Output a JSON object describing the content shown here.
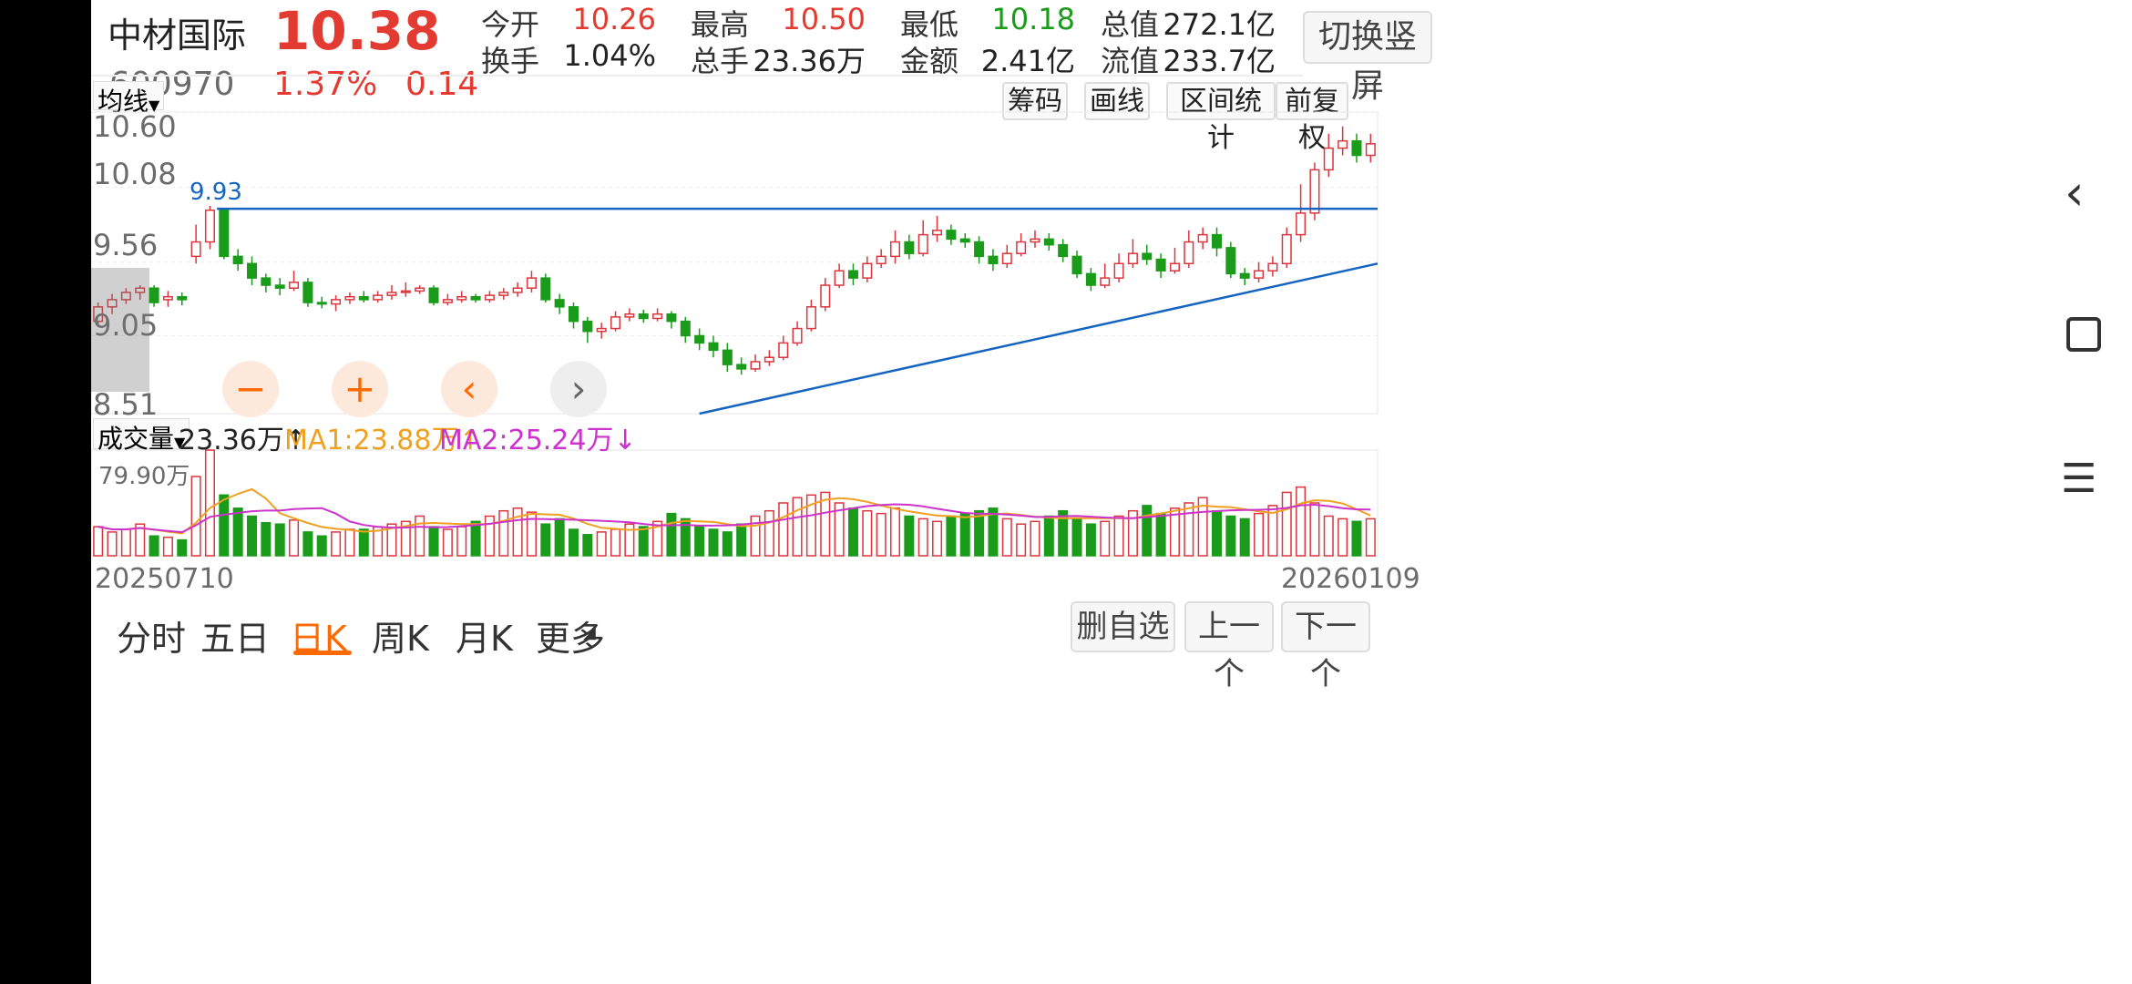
{
  "header": {
    "stock_name": "中材国际",
    "price": "10.38",
    "code": "600970",
    "change_pct": "1.37%",
    "change": "0.14",
    "fields": [
      {
        "label": "今开",
        "value": "10.26",
        "color": "#e33b32"
      },
      {
        "label": "最高",
        "value": "10.50",
        "color": "#e33b32"
      },
      {
        "label": "最低",
        "value": "10.18",
        "color": "#1a9c1a"
      },
      {
        "label": "总值",
        "value": "272.1亿",
        "color": "#222222"
      },
      {
        "label": "换手",
        "value": "1.04%",
        "color": "#222222"
      },
      {
        "label": "总手",
        "value": "23.36万",
        "color": "#222222"
      },
      {
        "label": "金额",
        "value": "2.41亿",
        "color": "#222222"
      },
      {
        "label": "流值",
        "value": "233.7亿",
        "color": "#222222"
      }
    ],
    "switch_label": "切换竖屏"
  },
  "toolbar": {
    "ma_label": "均线",
    "buttons": [
      "筹码",
      "画线",
      "区间统计",
      "前复权"
    ]
  },
  "price_axis": {
    "ticks": [
      "10.60",
      "10.08",
      "9.56",
      "9.05",
      "8.51"
    ]
  },
  "annotations": {
    "high_label": "9.93"
  },
  "volume_header": {
    "label": "成交量",
    "value": "23.36万",
    "value_arrow": "↑",
    "ma1": "MA1:23.88万",
    "ma1_arrow": "↑",
    "ma2": "MA2:25.24万",
    "ma2_arrow": "↓",
    "max_label": "79.90万"
  },
  "dates": {
    "start": "20250710",
    "end": "20260109"
  },
  "controls": {
    "zoom_out": "−",
    "zoom_in": "+",
    "prev": "‹",
    "next": "›"
  },
  "tabs": [
    "分时",
    "五日",
    "日K",
    "周K",
    "月K",
    "更多"
  ],
  "active_tab": "日K",
  "bottom_buttons": [
    "删自选",
    "上一个",
    "下一个"
  ],
  "colors": {
    "up": "#d9363e",
    "down": "#1a9c1a",
    "ma1": "#f0a020",
    "ma2": "#cc33cc",
    "line": "#1565c0",
    "accent": "#ff6a00"
  },
  "chart_data": {
    "type": "candlestick",
    "title": "",
    "x_start": "20250710",
    "x_end": "20260109",
    "ylim": [
      8.51,
      10.6
    ],
    "volume_max": "79.90万",
    "candles": [
      [
        9.15,
        9.25,
        9.28,
        9.12
      ],
      [
        9.25,
        9.3,
        9.34,
        9.2
      ],
      [
        9.3,
        9.35,
        9.38,
        9.27
      ],
      [
        9.35,
        9.38,
        9.4,
        9.3
      ],
      [
        9.38,
        9.28,
        9.4,
        9.25
      ],
      [
        9.3,
        9.32,
        9.36,
        9.25
      ],
      [
        9.32,
        9.3,
        9.35,
        9.26
      ],
      [
        9.6,
        9.7,
        9.82,
        9.55
      ],
      [
        9.7,
        9.92,
        9.95,
        9.65
      ],
      [
        9.92,
        9.6,
        9.93,
        9.58
      ],
      [
        9.6,
        9.55,
        9.65,
        9.5
      ],
      [
        9.55,
        9.45,
        9.6,
        9.4
      ],
      [
        9.45,
        9.4,
        9.48,
        9.35
      ],
      [
        9.4,
        9.38,
        9.45,
        9.33
      ],
      [
        9.38,
        9.42,
        9.5,
        9.36
      ],
      [
        9.42,
        9.28,
        9.45,
        9.25
      ],
      [
        9.28,
        9.27,
        9.32,
        9.24
      ],
      [
        9.27,
        9.3,
        9.33,
        9.22
      ],
      [
        9.3,
        9.32,
        9.35,
        9.27
      ],
      [
        9.32,
        9.3,
        9.36,
        9.28
      ],
      [
        9.3,
        9.33,
        9.36,
        9.28
      ],
      [
        9.33,
        9.35,
        9.4,
        9.3
      ],
      [
        9.35,
        9.36,
        9.42,
        9.32
      ],
      [
        9.36,
        9.38,
        9.4,
        9.34
      ],
      [
        9.38,
        9.28,
        9.4,
        9.26
      ],
      [
        9.28,
        9.3,
        9.34,
        9.26
      ],
      [
        9.3,
        9.32,
        9.36,
        9.28
      ],
      [
        9.32,
        9.3,
        9.34,
        9.28
      ],
      [
        9.3,
        9.33,
        9.36,
        9.28
      ],
      [
        9.33,
        9.35,
        9.38,
        9.3
      ],
      [
        9.35,
        9.38,
        9.42,
        9.32
      ],
      [
        9.38,
        9.45,
        9.5,
        9.35
      ],
      [
        9.45,
        9.3,
        9.48,
        9.28
      ],
      [
        9.3,
        9.25,
        9.34,
        9.2
      ],
      [
        9.25,
        9.15,
        9.28,
        9.1
      ],
      [
        9.15,
        9.08,
        9.18,
        9.0
      ],
      [
        9.08,
        9.1,
        9.14,
        9.03
      ],
      [
        9.1,
        9.18,
        9.22,
        9.08
      ],
      [
        9.18,
        9.2,
        9.24,
        9.15
      ],
      [
        9.2,
        9.17,
        9.23,
        9.14
      ],
      [
        9.17,
        9.2,
        9.24,
        9.15
      ],
      [
        9.2,
        9.15,
        9.22,
        9.1
      ],
      [
        9.15,
        9.05,
        9.18,
        9.0
      ],
      [
        9.05,
        9.0,
        9.1,
        8.95
      ],
      [
        9.0,
        8.95,
        9.05,
        8.9
      ],
      [
        8.95,
        8.85,
        9.0,
        8.8
      ],
      [
        8.85,
        8.82,
        8.9,
        8.78
      ],
      [
        8.82,
        8.87,
        8.92,
        8.8
      ],
      [
        8.87,
        8.9,
        8.95,
        8.84
      ],
      [
        8.9,
        9.0,
        9.05,
        8.88
      ],
      [
        9.0,
        9.1,
        9.15,
        8.98
      ],
      [
        9.1,
        9.25,
        9.3,
        9.08
      ],
      [
        9.25,
        9.4,
        9.45,
        9.22
      ],
      [
        9.4,
        9.5,
        9.55,
        9.38
      ],
      [
        9.5,
        9.45,
        9.55,
        9.4
      ],
      [
        9.45,
        9.55,
        9.6,
        9.42
      ],
      [
        9.55,
        9.6,
        9.65,
        9.52
      ],
      [
        9.6,
        9.7,
        9.78,
        9.55
      ],
      [
        9.7,
        9.62,
        9.75,
        9.58
      ],
      [
        9.62,
        9.75,
        9.85,
        9.6
      ],
      [
        9.75,
        9.78,
        9.88,
        9.7
      ],
      [
        9.78,
        9.72,
        9.82,
        9.68
      ],
      [
        9.72,
        9.7,
        9.76,
        9.66
      ],
      [
        9.7,
        9.6,
        9.74,
        9.55
      ],
      [
        9.6,
        9.55,
        9.65,
        9.5
      ],
      [
        9.55,
        9.62,
        9.68,
        9.52
      ],
      [
        9.62,
        9.7,
        9.76,
        9.6
      ],
      [
        9.7,
        9.72,
        9.78,
        9.66
      ],
      [
        9.72,
        9.68,
        9.76,
        9.64
      ],
      [
        9.68,
        9.6,
        9.72,
        9.56
      ],
      [
        9.6,
        9.48,
        9.64,
        9.45
      ],
      [
        9.48,
        9.4,
        9.52,
        9.36
      ],
      [
        9.4,
        9.45,
        9.55,
        9.38
      ],
      [
        9.45,
        9.55,
        9.62,
        9.42
      ],
      [
        9.55,
        9.62,
        9.72,
        9.52
      ],
      [
        9.62,
        9.58,
        9.68,
        9.54
      ],
      [
        9.58,
        9.5,
        9.62,
        9.45
      ],
      [
        9.5,
        9.55,
        9.66,
        9.48
      ],
      [
        9.55,
        9.7,
        9.78,
        9.52
      ],
      [
        9.7,
        9.75,
        9.8,
        9.65
      ],
      [
        9.75,
        9.66,
        9.8,
        9.6
      ],
      [
        9.66,
        9.48,
        9.7,
        9.45
      ],
      [
        9.48,
        9.45,
        9.52,
        9.4
      ],
      [
        9.45,
        9.5,
        9.56,
        9.42
      ],
      [
        9.5,
        9.55,
        9.6,
        9.46
      ],
      [
        9.55,
        9.75,
        9.8,
        9.52
      ],
      [
        9.75,
        9.9,
        10.1,
        9.7
      ],
      [
        9.9,
        10.2,
        10.25,
        9.85
      ],
      [
        10.2,
        10.35,
        10.45,
        10.15
      ],
      [
        10.35,
        10.4,
        10.5,
        10.3
      ],
      [
        10.4,
        10.3,
        10.45,
        10.25
      ],
      [
        10.3,
        10.38,
        10.45,
        10.25
      ]
    ],
    "volumes": [
      22,
      18,
      20,
      24,
      15,
      14,
      12,
      60,
      80,
      46,
      36,
      30,
      25,
      24,
      27,
      18,
      15,
      18,
      20,
      20,
      22,
      24,
      26,
      30,
      22,
      20,
      22,
      26,
      30,
      34,
      36,
      33,
      24,
      28,
      20,
      16,
      18,
      20,
      24,
      22,
      26,
      32,
      28,
      22,
      20,
      18,
      24,
      30,
      34,
      40,
      44,
      46,
      48,
      40,
      36,
      34,
      32,
      36,
      30,
      28,
      26,
      30,
      32,
      34,
      36,
      28,
      24,
      26,
      30,
      34,
      28,
      24,
      26,
      30,
      34,
      38,
      32,
      36,
      40,
      44,
      34,
      30,
      28,
      32,
      38,
      48,
      52,
      40,
      30,
      28,
      26,
      28
    ]
  }
}
